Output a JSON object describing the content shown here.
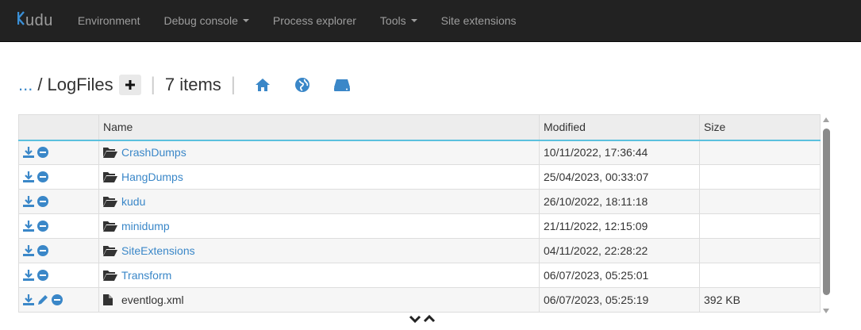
{
  "brand": {
    "text": "udu"
  },
  "nav": {
    "items": [
      {
        "label": "Environment",
        "dropdown": false
      },
      {
        "label": "Debug console",
        "dropdown": true
      },
      {
        "label": "Process explorer",
        "dropdown": false
      },
      {
        "label": "Tools",
        "dropdown": true
      },
      {
        "label": "Site extensions",
        "dropdown": false
      }
    ]
  },
  "breadcrumb": {
    "ellipsis": "...",
    "slash": "/",
    "folder": "LogFiles",
    "item_count": "7 items"
  },
  "table": {
    "headers": {
      "name": "Name",
      "modified": "Modified",
      "size": "Size"
    },
    "rows": [
      {
        "type": "folder",
        "name": "CrashDumps",
        "modified": "10/11/2022, 17:36:44",
        "size": ""
      },
      {
        "type": "folder",
        "name": "HangDumps",
        "modified": "25/04/2023, 00:33:07",
        "size": ""
      },
      {
        "type": "folder",
        "name": "kudu",
        "modified": "26/10/2022, 18:11:18",
        "size": ""
      },
      {
        "type": "folder",
        "name": "minidump",
        "modified": "21/11/2022, 12:15:09",
        "size": ""
      },
      {
        "type": "folder",
        "name": "SiteExtensions",
        "modified": "04/11/2022, 22:28:22",
        "size": ""
      },
      {
        "type": "folder",
        "name": "Transform",
        "modified": "06/07/2023, 05:25:01",
        "size": ""
      },
      {
        "type": "file",
        "name": "eventlog.xml",
        "modified": "06/07/2023, 05:25:19",
        "size": "392 KB"
      }
    ]
  },
  "colors": {
    "accent": "#3a87c8",
    "navbar": "#222222",
    "header_rule": "#5bc0de"
  },
  "icons": {
    "row_actions_folder": [
      "download-icon",
      "delete-icon"
    ],
    "row_actions_file": [
      "download-icon",
      "edit-icon",
      "delete-icon"
    ],
    "breadcrumb": [
      "plus-icon",
      "home-icon",
      "globe-icon",
      "drive-icon"
    ]
  }
}
